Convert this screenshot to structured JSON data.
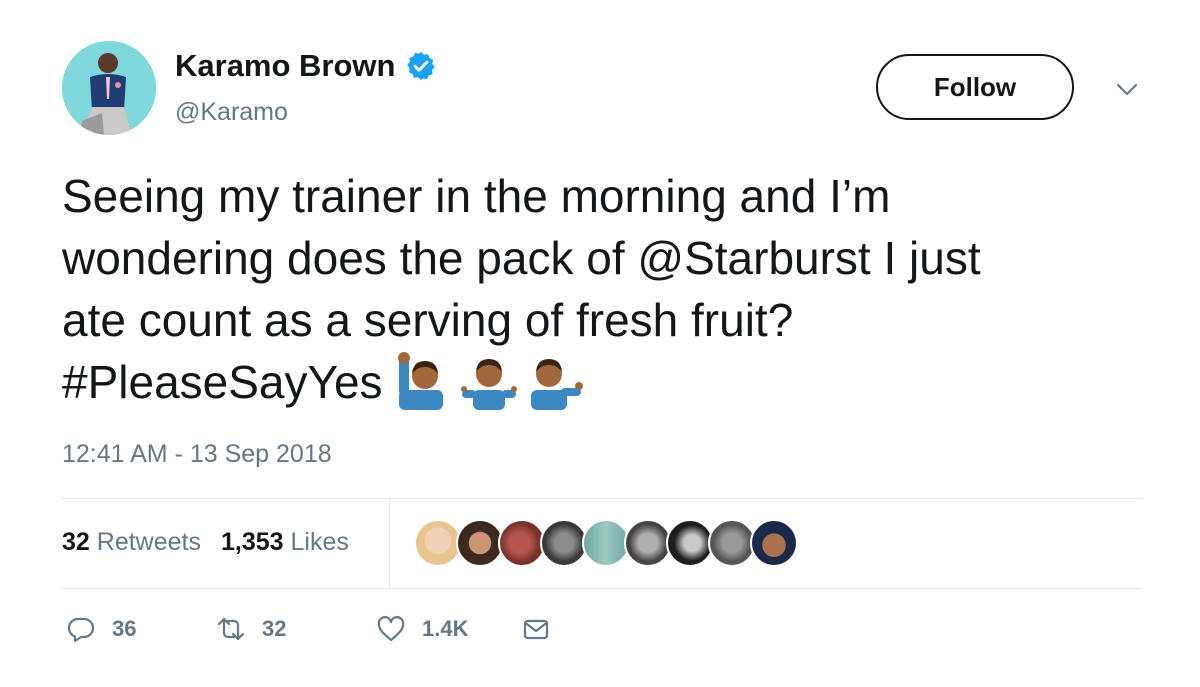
{
  "user": {
    "display_name": "Karamo Brown",
    "handle": "@Karamo",
    "verified": true
  },
  "header": {
    "follow_label": "Follow"
  },
  "tweet": {
    "lines": [
      "Seeing my trainer in the morning and I’m",
      "wondering does the pack of @Starburst I just",
      "ate count as a serving of fresh fruit?",
      "#PleaseSayYes"
    ],
    "emojis": [
      "person-raising-hand-emoji",
      "person-shrugging-emoji",
      "person-tipping-hand-emoji"
    ],
    "timestamp": "12:41 AM - 13 Sep 2018"
  },
  "stats": {
    "retweets_count": "32",
    "retweets_label": "Retweets",
    "likes_count": "1,353",
    "likes_label": "Likes",
    "liker_avatar_count": 9
  },
  "actions": {
    "reply_count": "36",
    "retweet_count": "32",
    "like_count": "1.4K"
  },
  "colors": {
    "verified": "#1da1f2",
    "muted_text": "#657786",
    "divider": "#e1e8ed",
    "avatar_bg": "#7fd8dc"
  }
}
